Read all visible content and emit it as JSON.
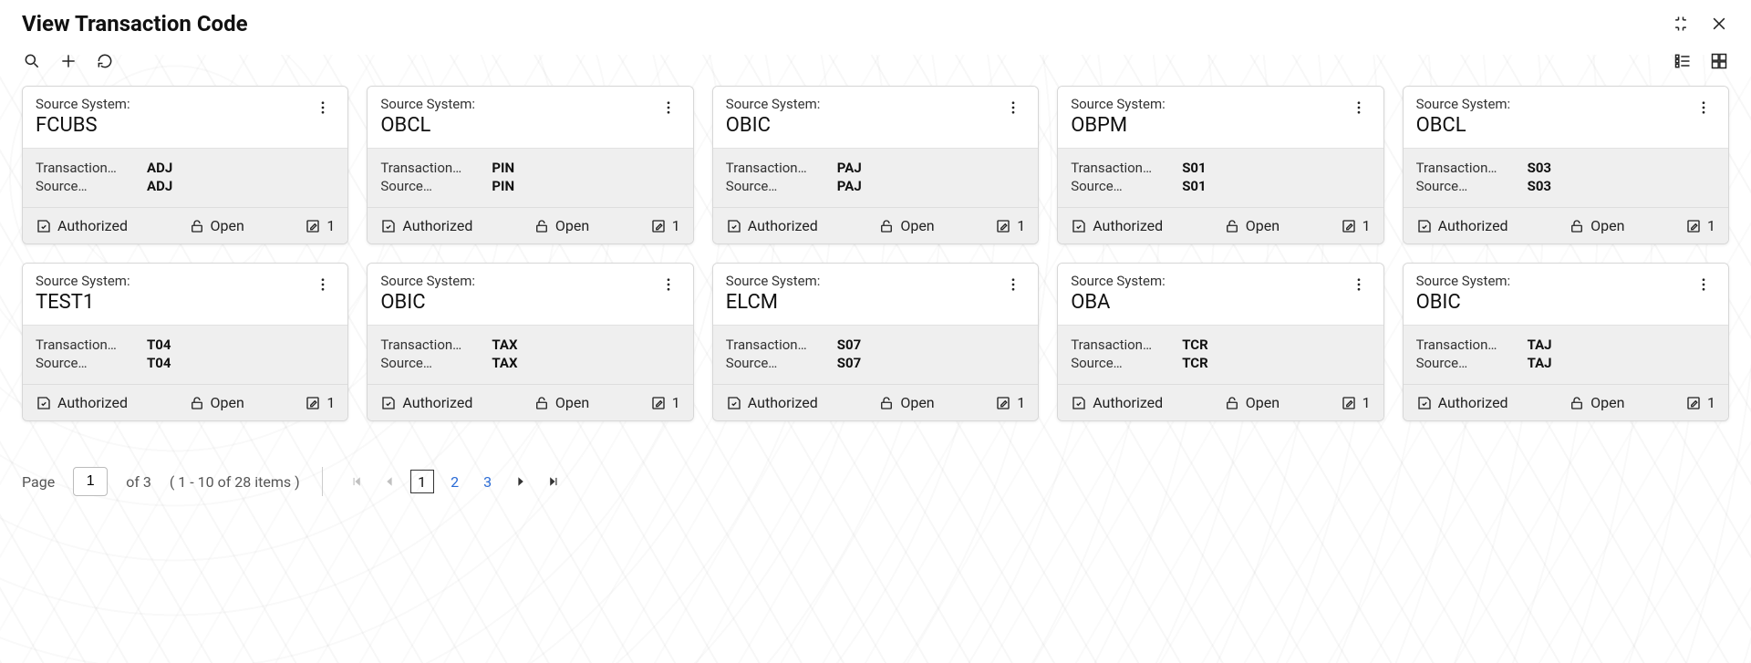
{
  "title": "View Transaction Code",
  "labels": {
    "source_system": "Source System:",
    "transaction": "Transaction…",
    "source": "Source…",
    "authorized": "Authorized",
    "open": "Open"
  },
  "cards": [
    {
      "system": "FCUBS",
      "txn": "ADJ",
      "src": "ADJ",
      "count": "1"
    },
    {
      "system": "OBCL",
      "txn": "PIN",
      "src": "PIN",
      "count": "1"
    },
    {
      "system": "OBIC",
      "txn": "PAJ",
      "src": "PAJ",
      "count": "1"
    },
    {
      "system": "OBPM",
      "txn": "S01",
      "src": "S01",
      "count": "1"
    },
    {
      "system": "OBCL",
      "txn": "S03",
      "src": "S03",
      "count": "1"
    },
    {
      "system": "TEST1",
      "txn": "T04",
      "src": "T04",
      "count": "1"
    },
    {
      "system": "OBIC",
      "txn": "TAX",
      "src": "TAX",
      "count": "1"
    },
    {
      "system": "ELCM",
      "txn": "S07",
      "src": "S07",
      "count": "1"
    },
    {
      "system": "OBA",
      "txn": "TCR",
      "src": "TCR",
      "count": "1"
    },
    {
      "system": "OBIC",
      "txn": "TAJ",
      "src": "TAJ",
      "count": "1"
    }
  ],
  "pagination": {
    "page_label": "Page",
    "current": "1",
    "of_label": "of 3",
    "range": "( 1 - 10 of 28 items )",
    "pages": [
      "1",
      "2",
      "3"
    ]
  }
}
